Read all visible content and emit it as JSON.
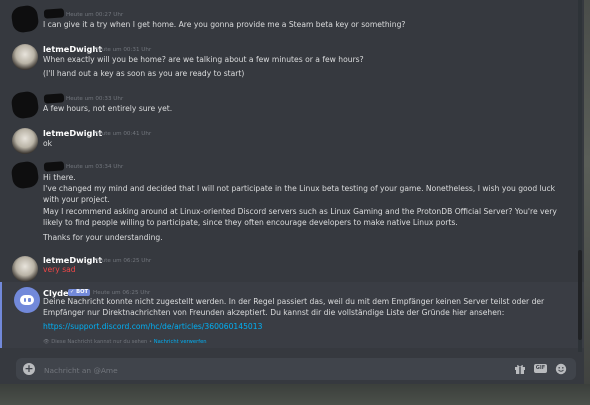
{
  "messages": [
    {
      "author": "",
      "redacted": true,
      "timestamp": "Heute um 00:27 Uhr",
      "lines": [
        "I can give it a try when I get home. Are you gonna provide me a Steam beta key or something?"
      ]
    },
    {
      "author": "letmeDwight",
      "timestamp": "Heute um 00:31 Uhr",
      "lines": [
        "When exactly will you be home? are we talking about a few minutes or a few hours?",
        "(I'll hand out a key as soon as you are ready to start)"
      ]
    },
    {
      "author": "",
      "redacted": true,
      "timestamp": "Heute um 00:33 Uhr",
      "lines": [
        "A few hours, not entirely sure yet."
      ]
    },
    {
      "author": "letmeDwight",
      "timestamp": "Heute um 00:41 Uhr",
      "lines": [
        "ok"
      ]
    },
    {
      "author": "",
      "redacted": true,
      "timestamp": "Heute um 03:34 Uhr",
      "lines": [
        "Hi there.",
        "I've changed my mind and decided that I will not participate in the Linux beta testing of your game. Nonetheless, I wish you good luck with your project.",
        "May I recommend asking around at Linux-oriented Discord servers such as Linux Gaming and the ProtonDB Official Server? You're very likely to find people willing to participate, since they often encourage developers to make native Linux ports.",
        "Thanks for your understanding."
      ]
    },
    {
      "author": "letmeDwight",
      "timestamp": "Heute um 06:25 Uhr",
      "lines": [
        "very sad"
      ],
      "color": "#f04747"
    }
  ],
  "clyde": {
    "author": "Clyde",
    "bot_tag": "✓ BOT",
    "timestamp": "Heute um 06:25 Uhr",
    "text": "Deine Nachricht konnte nicht zugestellt werden. In der Regel passiert das, weil du mit dem Empfänger keinen Server teilst oder der Empfänger nur Direktnachrichten von Freunden akzeptiert. Du kannst dir die vollständige Liste der Gründe hier ansehen:",
    "link": "https://support.discord.com/hc/de/articles/360060145013",
    "notice": "Diese Nachricht kannst nur du sehen •",
    "dismiss": "Nachricht verwerfen"
  },
  "composer": {
    "placeholder": "Nachricht an @Ame",
    "gif_label": "GIF"
  },
  "colors": {
    "background": "#36393f",
    "link": "#00b0f4",
    "accent": "#7289da",
    "danger": "#f04747"
  }
}
